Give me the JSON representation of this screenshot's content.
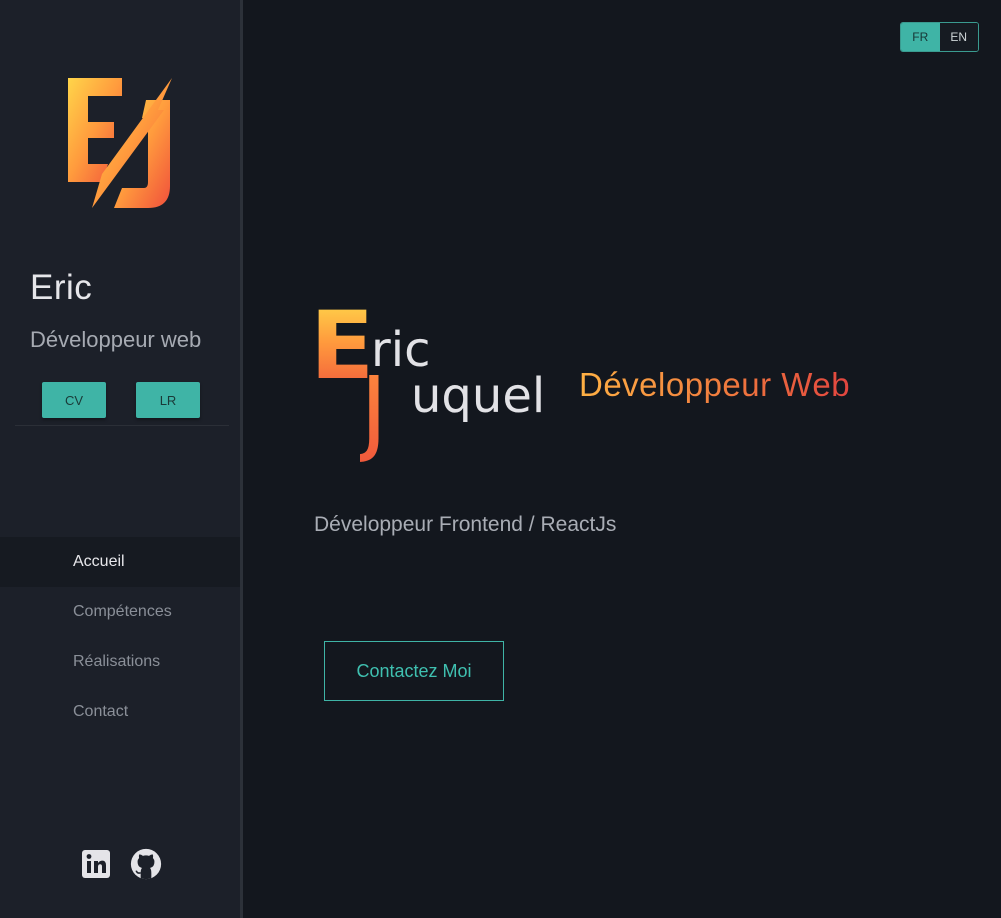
{
  "sidebar": {
    "logo_text": "EJ",
    "name": "Eric",
    "role": "Développeur web",
    "buttons": {
      "cv": "CV",
      "lr": "LR"
    },
    "nav": [
      {
        "label": "Accueil",
        "active": true
      },
      {
        "label": "Compétences",
        "active": false
      },
      {
        "label": "Réalisations",
        "active": false
      },
      {
        "label": "Contact",
        "active": false
      }
    ],
    "social_icons": [
      "linkedin-icon",
      "github-icon"
    ]
  },
  "language": {
    "fr": "FR",
    "en": "EN",
    "selected": "FR"
  },
  "hero": {
    "logo_e": "E",
    "logo_ric": "ric",
    "logo_j": "J",
    "logo_uquel": "uquel",
    "title": "Développeur Web",
    "subtitle": "Développeur Frontend / ReactJs",
    "contact_button": "Contactez Moi"
  },
  "colors": {
    "accent": "#3fb4a6",
    "gradient_start": "#ffd54a",
    "gradient_end": "#e2453f",
    "sidebar_bg": "#1c2029",
    "main_bg": "#13171e"
  }
}
